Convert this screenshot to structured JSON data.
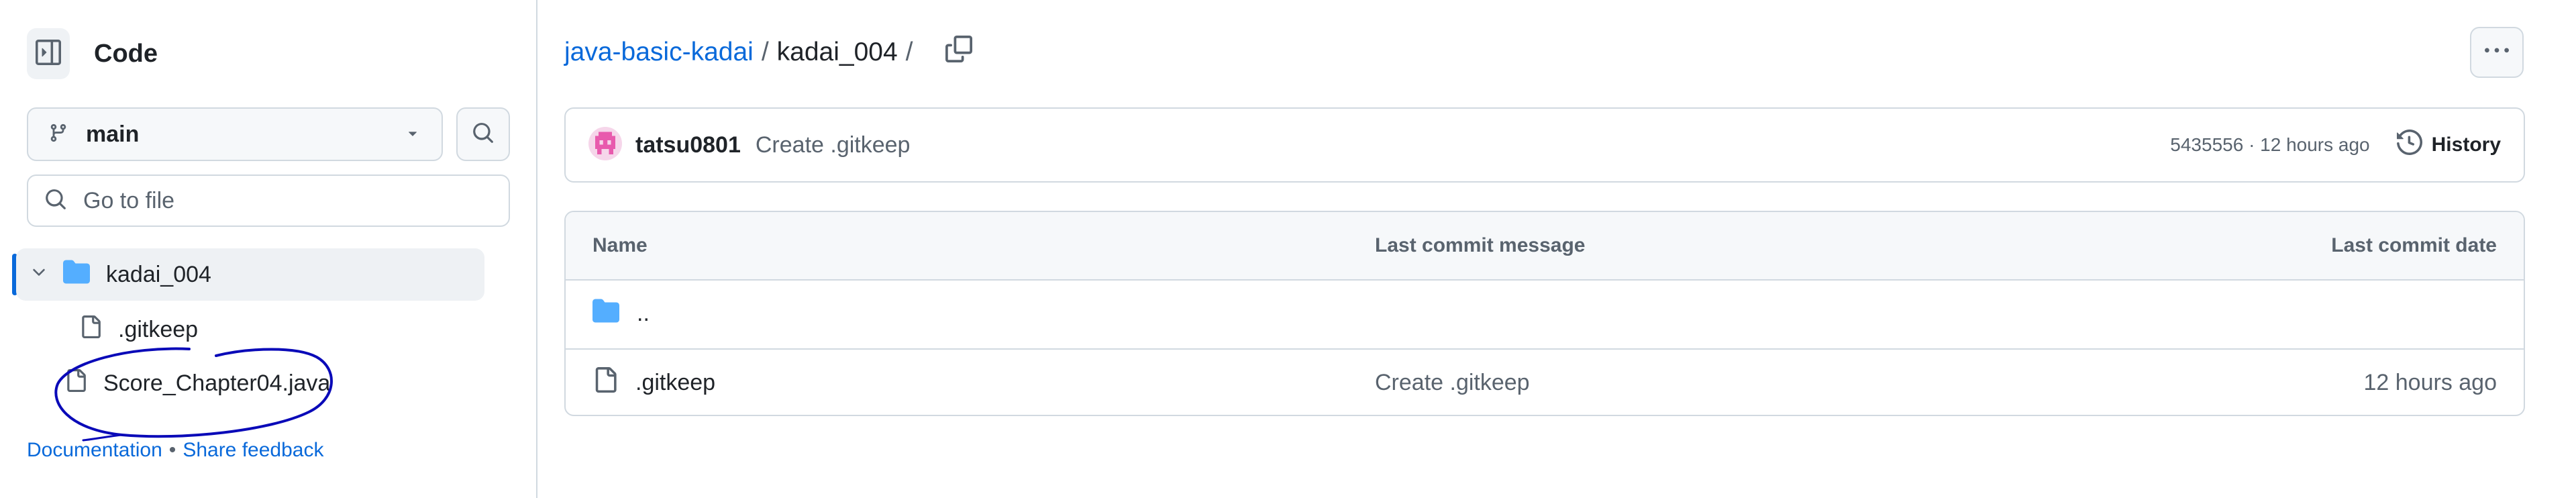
{
  "sidebar": {
    "title": "Code",
    "branch": {
      "label": "main"
    },
    "goto_file": {
      "placeholder": "Go to file",
      "value": ""
    },
    "tree": {
      "folder": {
        "label": "kadai_004"
      },
      "files": [
        {
          "label": ".gitkeep"
        },
        {
          "label": "Score_Chapter04.java"
        }
      ]
    },
    "footer": {
      "documentation": "Documentation",
      "separator": "•",
      "share_feedback": "Share feedback"
    }
  },
  "breadcrumb": {
    "repo": "java-basic-kadai",
    "separator": "/",
    "folder": "kadai_004",
    "trailing": "/"
  },
  "commit": {
    "author": "tatsu0801",
    "message": "Create .gitkeep",
    "meta": "5435556 · 12 hours ago",
    "history_label": "History"
  },
  "table": {
    "headers": {
      "name": "Name",
      "last_commit_message": "Last commit message",
      "last_commit_date": "Last commit date"
    },
    "rows": [
      {
        "name": "..",
        "message": "",
        "date": ""
      },
      {
        "name": ".gitkeep",
        "message": "Create .gitkeep",
        "date": "12 hours ago"
      }
    ]
  },
  "colors": {
    "accent": "#0969da",
    "folder": "#54aeff",
    "annotation": "#0a0ab8",
    "avatar": "#e85aad"
  }
}
